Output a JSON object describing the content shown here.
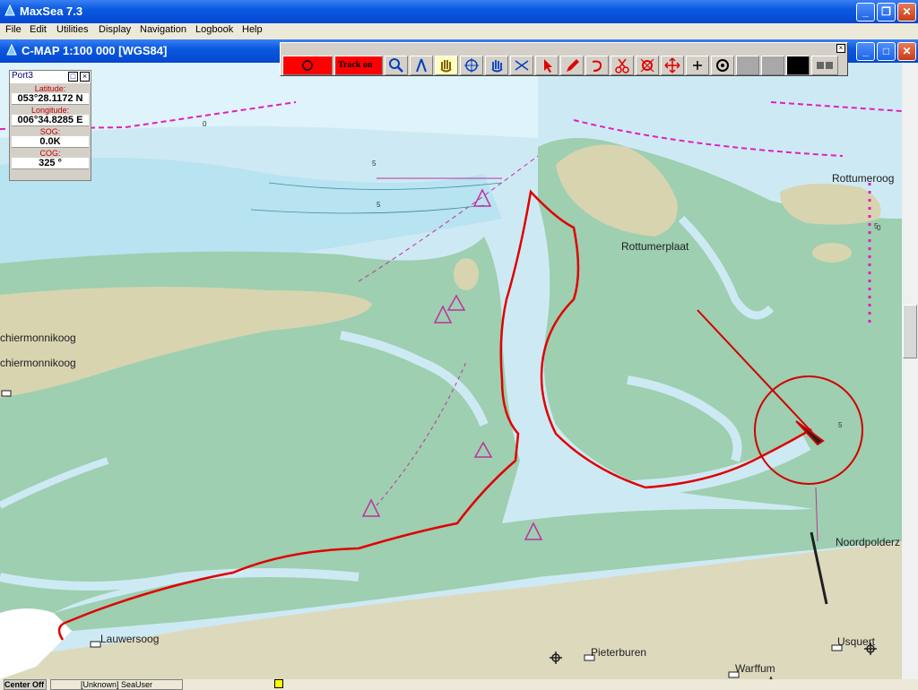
{
  "app": {
    "title": "MaxSea 7.3"
  },
  "menu": [
    "File",
    "Edit",
    "Utilities",
    "Display",
    "Navigation",
    "Logbook",
    "Help"
  ],
  "chart_window": {
    "title": "C-MAP  1:100 000 [WGS84]"
  },
  "toolbar": {
    "track_label": "Track on",
    "tools": [
      "mob-icon",
      "zoom-icon",
      "compass-divider-icon",
      "hand-pan-icon",
      "crosshair-icon",
      "hand-select-icon",
      "arrows-icon",
      "pointer-icon",
      "pencil-icon",
      "route-icon",
      "scissors-icon",
      "target-icon",
      "move-icon",
      "plus-icon",
      "circle-dot-icon"
    ]
  },
  "infobox": {
    "title": "Port3",
    "fields": [
      {
        "label": "Latitude:",
        "value": "053°28.1172 N"
      },
      {
        "label": "Longitude:",
        "value": "006°34.8285 E"
      },
      {
        "label": "SOG:",
        "value": "0.0K"
      },
      {
        "label": "COG:",
        "value": "325 °"
      }
    ]
  },
  "places": {
    "rottumerplaat": "Rottumerplaat",
    "rottumeroog": "Rottumeroog",
    "schiermonnikoog1": "chiermonnikoog",
    "schiermonnikoog2": "chiermonnikoog",
    "lauwersoog": "Lauwersoog",
    "pieterburen": "Pieterburen",
    "warffum": "Warffum",
    "usquert": "Usquert",
    "noordpolder": "Noordpolderz"
  },
  "depth_labels": [
    "0",
    "5",
    "5",
    "5",
    "5",
    "0"
  ],
  "statusbar": {
    "center": "Center Off",
    "user": "[Unknown] SeaUser"
  },
  "colors": {
    "land": "#d8d4b0",
    "shoal": "#9dcfb0",
    "water": "#cdeaf4",
    "track": "#e00000"
  }
}
